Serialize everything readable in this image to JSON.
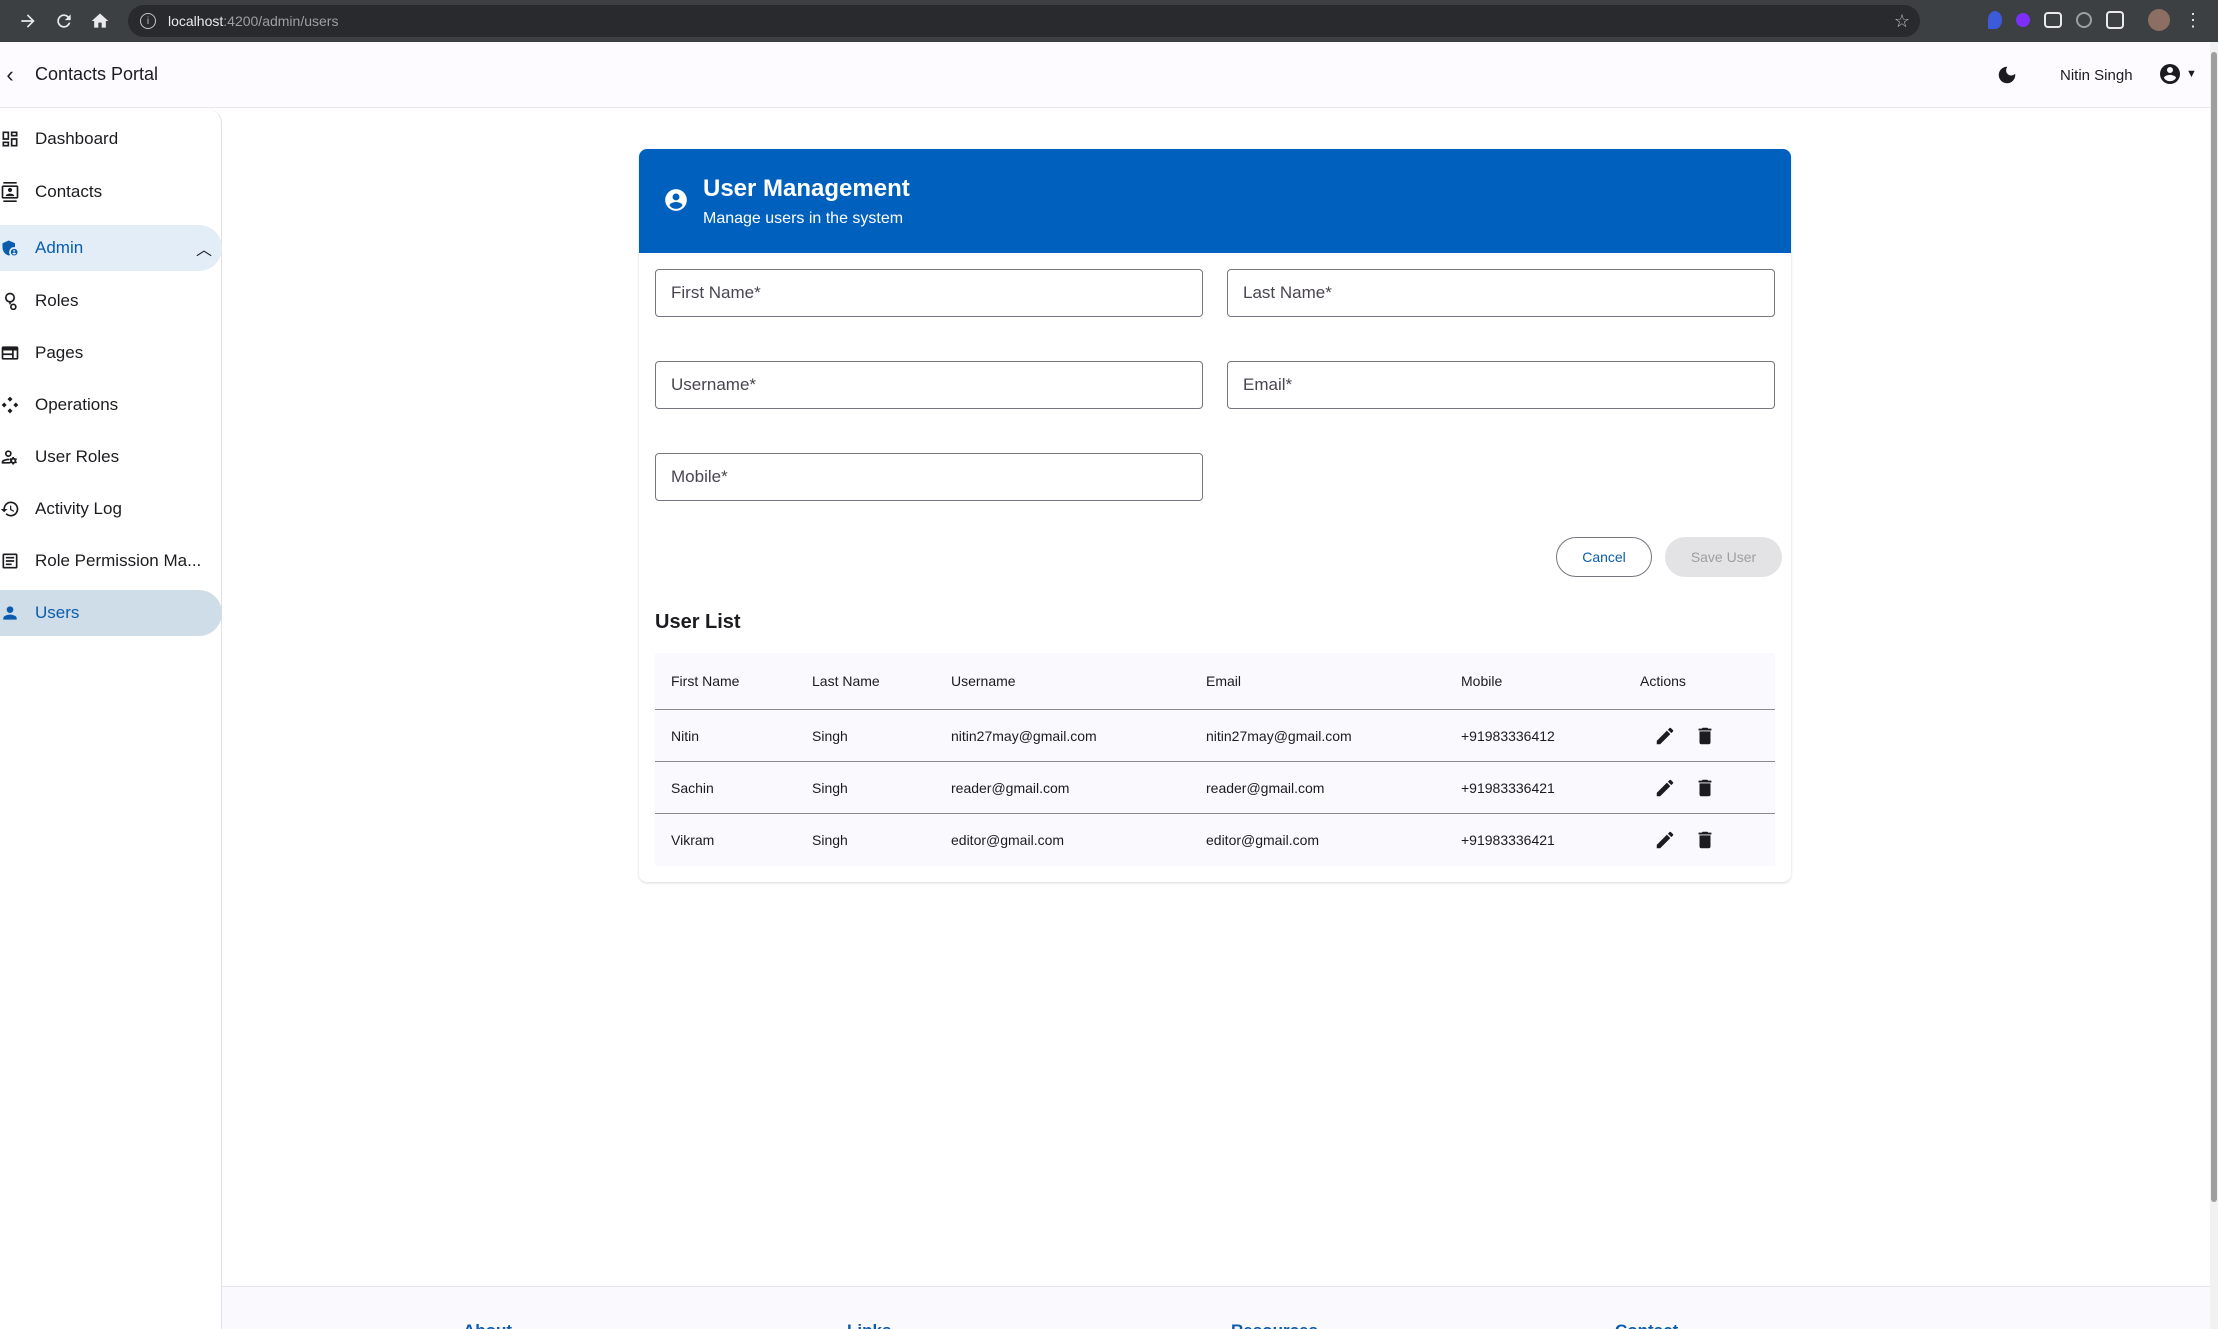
{
  "browser": {
    "url_host": "localhost",
    "url_path": ":4200/admin/users"
  },
  "app": {
    "title": "Contacts Portal",
    "user_name": "Nitin Singh"
  },
  "sidebar": {
    "items": [
      {
        "label": "Dashboard",
        "icon": "dashboard-icon"
      },
      {
        "label": "Contacts",
        "icon": "contacts-icon"
      },
      {
        "label": "Admin",
        "icon": "admin-icon",
        "expanded": true
      },
      {
        "label": "Roles",
        "icon": "roles-icon"
      },
      {
        "label": "Pages",
        "icon": "pages-icon"
      },
      {
        "label": "Operations",
        "icon": "operations-icon"
      },
      {
        "label": "User Roles",
        "icon": "user-roles-icon"
      },
      {
        "label": "Activity Log",
        "icon": "history-icon"
      },
      {
        "label": "Role Permission Ma...",
        "icon": "list-icon"
      },
      {
        "label": "Users",
        "icon": "person-icon",
        "active": true
      }
    ]
  },
  "card": {
    "title": "User Management",
    "subtitle": "Manage users in the system"
  },
  "form": {
    "first_name_placeholder": "First Name*",
    "last_name_placeholder": "Last Name*",
    "username_placeholder": "Username*",
    "email_placeholder": "Email*",
    "mobile_placeholder": "Mobile*",
    "cancel_label": "Cancel",
    "save_label": "Save User"
  },
  "user_list": {
    "title": "User List",
    "columns": [
      "First Name",
      "Last Name",
      "Username",
      "Email",
      "Mobile",
      "Actions"
    ],
    "rows": [
      {
        "first_name": "Nitin",
        "last_name": "Singh",
        "username": "nitin27may@gmail.com",
        "email": "nitin27may@gmail.com",
        "mobile": "+91983336412"
      },
      {
        "first_name": "Sachin",
        "last_name": "Singh",
        "username": "reader@gmail.com",
        "email": "reader@gmail.com",
        "mobile": "+91983336421"
      },
      {
        "first_name": "Vikram",
        "last_name": "Singh",
        "username": "editor@gmail.com",
        "email": "editor@gmail.com",
        "mobile": "+91983336421"
      }
    ]
  },
  "footer": {
    "headings": [
      "About",
      "Links",
      "Resources",
      "Contact"
    ]
  },
  "colors": {
    "primary": "#0060bd",
    "active_nav_bg": "#cfdde9",
    "link_blue": "#0b5cad"
  }
}
